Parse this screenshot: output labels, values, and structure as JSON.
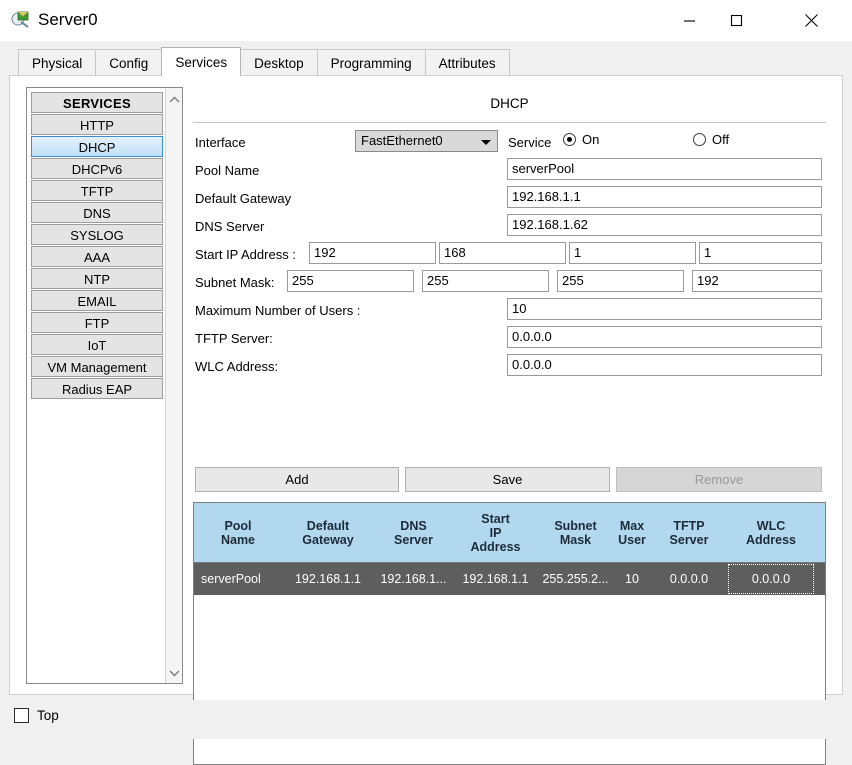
{
  "window": {
    "title": "Server0",
    "icon": "server-device-icon",
    "controls": {
      "minimize": "minimize-icon",
      "maximize": "maximize-icon",
      "close": "close-icon"
    }
  },
  "tabs": [
    {
      "label": "Physical",
      "active": false
    },
    {
      "label": "Config",
      "active": false
    },
    {
      "label": "Services",
      "active": true
    },
    {
      "label": "Desktop",
      "active": false
    },
    {
      "label": "Programming",
      "active": false
    },
    {
      "label": "Attributes",
      "active": false
    }
  ],
  "sidebar": {
    "items": [
      {
        "label": "SERVICES",
        "type": "header",
        "selected": false
      },
      {
        "label": "HTTP",
        "type": "item",
        "selected": false
      },
      {
        "label": "DHCP",
        "type": "item",
        "selected": true
      },
      {
        "label": "DHCPv6",
        "type": "item",
        "selected": false
      },
      {
        "label": "TFTP",
        "type": "item",
        "selected": false
      },
      {
        "label": "DNS",
        "type": "item",
        "selected": false
      },
      {
        "label": "SYSLOG",
        "type": "item",
        "selected": false
      },
      {
        "label": "AAA",
        "type": "item",
        "selected": false
      },
      {
        "label": "NTP",
        "type": "item",
        "selected": false
      },
      {
        "label": "EMAIL",
        "type": "item",
        "selected": false
      },
      {
        "label": "FTP",
        "type": "item",
        "selected": false
      },
      {
        "label": "IoT",
        "type": "item",
        "selected": false
      },
      {
        "label": "VM Management",
        "type": "item",
        "selected": false
      },
      {
        "label": "Radius EAP",
        "type": "item",
        "selected": false
      }
    ],
    "scrollbar": {
      "up_icon": "chevron-up-icon",
      "down_icon": "chevron-down-icon"
    }
  },
  "form": {
    "title": "DHCP",
    "interface": {
      "label": "Interface",
      "value": "FastEthernet0",
      "arrow_icon": "chevron-down-icon"
    },
    "service": {
      "label": "Service",
      "on_label": "On",
      "off_label": "Off",
      "selected": "On"
    },
    "pool_name": {
      "label": "Pool Name",
      "value": "serverPool"
    },
    "default_gateway": {
      "label": "Default Gateway",
      "value": "192.168.1.1"
    },
    "dns_server": {
      "label": "DNS Server",
      "value": "192.168.1.62"
    },
    "start_ip": {
      "label": "Start IP Address :",
      "octets": [
        "192",
        "168",
        "1",
        "1"
      ]
    },
    "subnet_mask": {
      "label": "Subnet Mask:",
      "octets": [
        "255",
        "255",
        "255",
        "192"
      ]
    },
    "max_users": {
      "label": "Maximum Number of Users :",
      "value": "10"
    },
    "tftp_server": {
      "label": "TFTP Server:",
      "value": "0.0.0.0"
    },
    "wlc_address": {
      "label": "WLC Address:",
      "value": "0.0.0.0"
    },
    "buttons": {
      "add": "Add",
      "save": "Save",
      "remove": "Remove"
    }
  },
  "table": {
    "headers": [
      "Pool\nName",
      "Default\nGateway",
      "DNS\nServer",
      "Start\nIP\nAddress",
      "Subnet\nMask",
      "Max\nUser",
      "TFTP\nServer",
      "WLC\nAddress"
    ],
    "rows": [
      {
        "selected": true,
        "cells": [
          "serverPool",
          "192.168.1.1",
          "192.168.1...",
          "192.168.1.1",
          "255.255.2...",
          "10",
          "0.0.0.0",
          "0.0.0.0"
        ]
      }
    ]
  },
  "bottom": {
    "top_checkbox": {
      "label": "Top",
      "checked": false
    }
  },
  "colors": {
    "table_header_bg": "#b2d8f0",
    "table_row_selected_bg": "#5e5e5e",
    "sidebar_selected_border": "#3c8ed0",
    "window_bg": "#f0f0f0"
  }
}
